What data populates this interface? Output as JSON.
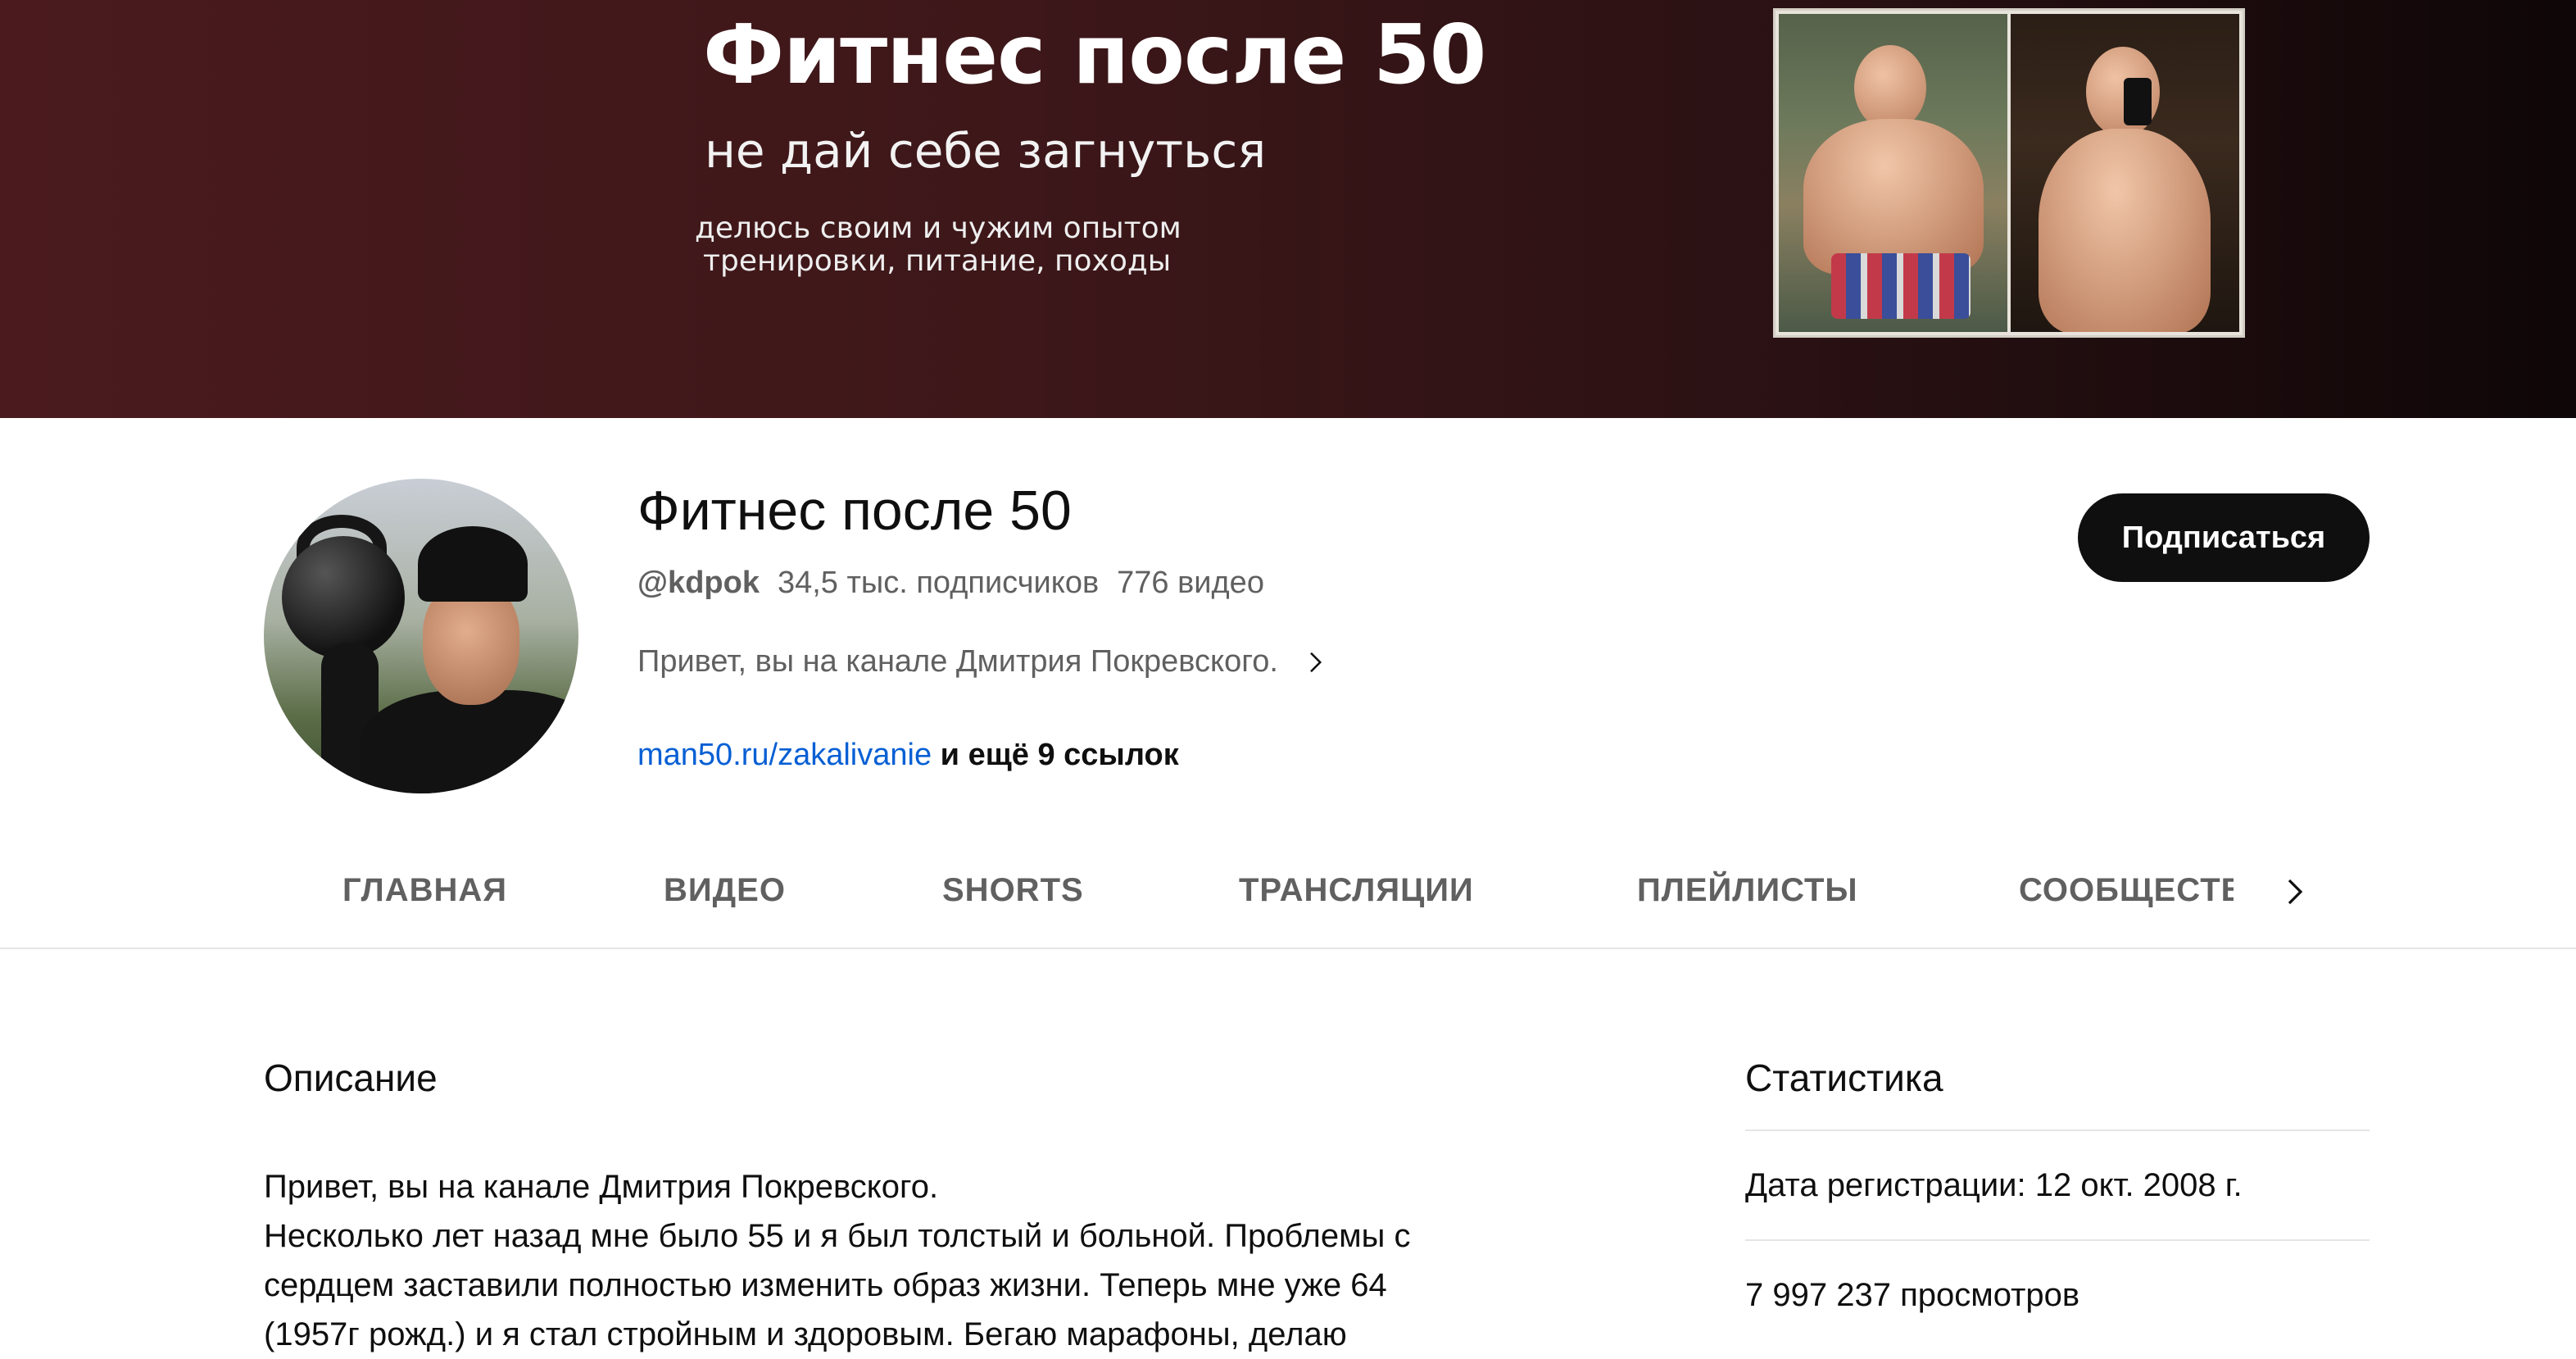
{
  "banner": {
    "title": "Фитнес после 50",
    "subtitle": "не дай себе загнуться",
    "line1": "делюсь своим и чужим опытом",
    "line2": "тренировки, питание, походы"
  },
  "channel": {
    "name": "Фитнес после 50",
    "handle": "@kdpok",
    "subscribers": "34,5 тыс. подписчиков",
    "videos": "776 видео",
    "short_description": "Привет, вы на канале Дмитрия Покревского.",
    "link": "man50.ru/zakalivanie",
    "more_links": " и ещё 9 ссылок",
    "subscribe_label": "Подписаться"
  },
  "tabs": [
    {
      "label": "ГЛАВНАЯ"
    },
    {
      "label": "ВИДЕО"
    },
    {
      "label": "SHORTS"
    },
    {
      "label": "ТРАНСЛЯЦИИ"
    },
    {
      "label": "ПЛЕЙЛИСТЫ"
    },
    {
      "label": "СООБЩЕСТВО"
    }
  ],
  "about": {
    "description_title": "Описание",
    "description_lines": [
      "Привет, вы на канале  Дмитрия Покревского.",
      "Несколько лет назад мне было 55 и я был толстый и больной. Проблемы с",
      "сердцем  заставили полностью изменить образ жизни.  Теперь мне уже 64",
      "(1957г рожд.)  и я стал стройным и здоровым. Бегаю марафоны, делаю"
    ],
    "stats_title": "Статистика",
    "registration": "Дата регистрации: 12 окт. 2008 г.",
    "views": "7 997 237 просмотров"
  }
}
